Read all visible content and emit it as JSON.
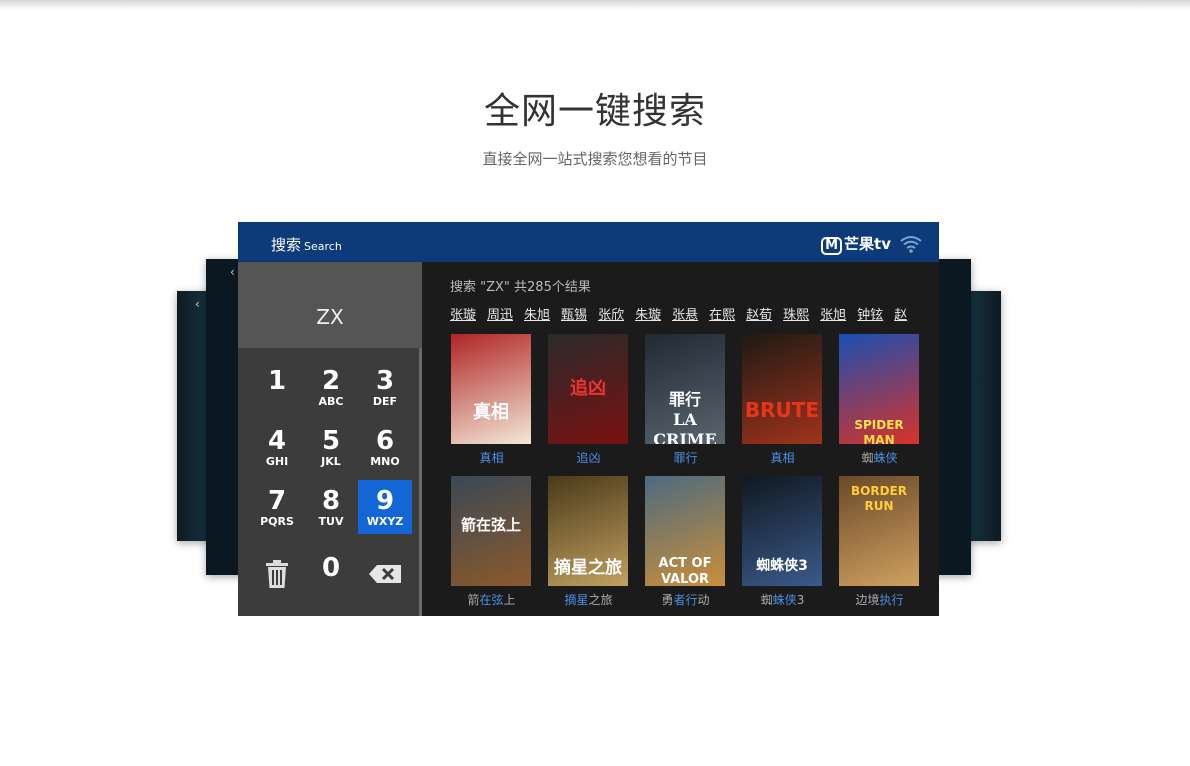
{
  "page": {
    "headline": "全网一键搜索",
    "subline": "直接全网一站式搜索您想看的节目"
  },
  "app": {
    "title": "搜索",
    "title_en": "Search",
    "logo_text": "芒果tv",
    "logo_mark": "M"
  },
  "keypad": {
    "input_value": "ZX",
    "keys": [
      {
        "num": "1",
        "letters": ""
      },
      {
        "num": "2",
        "letters": "ABC"
      },
      {
        "num": "3",
        "letters": "DEF"
      },
      {
        "num": "4",
        "letters": "GHI"
      },
      {
        "num": "5",
        "letters": "JKL"
      },
      {
        "num": "6",
        "letters": "MNO"
      },
      {
        "num": "7",
        "letters": "PQRS"
      },
      {
        "num": "8",
        "letters": "TUV"
      },
      {
        "num": "9",
        "letters": "WXYZ",
        "active": true
      }
    ],
    "zero": "0",
    "delete_icon": "trash-icon",
    "backspace_icon": "backspace-icon"
  },
  "results": {
    "summary": "搜索 \"ZX\" 共285个结果",
    "tags": [
      "张璇",
      "周迅",
      "朱旭",
      "甄锡",
      "张欣",
      "朱璇",
      "张悬",
      "在熙",
      "赵荀",
      "珠熙",
      "张旭",
      "钟铉",
      "赵"
    ],
    "posters": [
      {
        "art": "真相",
        "caption": [
          {
            "t": "真相",
            "h": true
          }
        ]
      },
      {
        "art": "追凶",
        "caption": [
          {
            "t": "追凶",
            "h": true
          }
        ]
      },
      {
        "art": "罪行\nLA CRIME",
        "caption": [
          {
            "t": "罪行",
            "h": true
          }
        ]
      },
      {
        "art": "BRUTE",
        "caption": [
          {
            "t": "真相",
            "h": true
          }
        ]
      },
      {
        "art": "SPIDER MAN",
        "caption": [
          {
            "t": "蜘",
            "h": false
          },
          {
            "t": "蛛侠",
            "h": true
          }
        ]
      },
      {
        "art": "箭在弦上",
        "caption": [
          {
            "t": "箭",
            "h": false
          },
          {
            "t": "在弦",
            "h": true
          },
          {
            "t": "上",
            "h": false
          }
        ]
      },
      {
        "art": "摘星之旅",
        "caption": [
          {
            "t": "摘星",
            "h": true
          },
          {
            "t": "之旅",
            "h": false
          }
        ]
      },
      {
        "art": "ACT OF VALOR",
        "caption": [
          {
            "t": "勇",
            "h": false
          },
          {
            "t": "者行",
            "h": true
          },
          {
            "t": "动",
            "h": false
          }
        ]
      },
      {
        "art": "蜘蛛侠3",
        "caption": [
          {
            "t": "蜘",
            "h": false
          },
          {
            "t": "蛛侠",
            "h": true
          },
          {
            "t": "3",
            "h": false
          }
        ]
      },
      {
        "art": "BORDER RUN",
        "caption": [
          {
            "t": "边境",
            "h": false
          },
          {
            "t": "执行",
            "h": true
          }
        ]
      }
    ]
  },
  "colors": {
    "topbar": "#0d3b7a",
    "active_key": "#1366d6",
    "caption_highlight": "#4a8fe8"
  }
}
